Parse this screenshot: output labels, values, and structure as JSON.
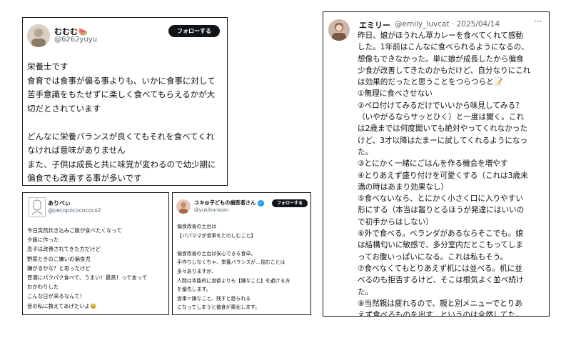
{
  "card1": {
    "name": "むむむ🍉",
    "handle": "@6262yuyu",
    "follow_label": "フォローする",
    "lines": [
      "栄養士です",
      "食育では食事が偏る事よりも、いかに食事に対して",
      "苦手意識をもたせずに楽しく食べてもらえるかが大",
      "切だとされています",
      "",
      "どんなに栄養バランスが良くてもそれを食べてくれ",
      "なければ意味がありません",
      "また、子供は成長と共に味覚が変わるので幼少期に",
      "偏食でも改善する事が多いです"
    ]
  },
  "card2": {
    "name": "ありべぃ",
    "handle": "@pecopococococo2",
    "lines": [
      "今日突然炊き込みご飯が食べたくなって",
      "夕飯に作った",
      "息子は改善されてきた方だけど",
      "野菜ときのこ嫌いの偏食児",
      "嫌がるかな？と思ったけど",
      "普通にパクパク食べて、うまい！最高！って言って",
      "おかわりした",
      "こんな日が来るなんて！",
      "昔の私に教えてあげたいよ🥹"
    ]
  },
  "card3": {
    "name": "ユキ@子どもの歯医者さん",
    "handle": "@yukiharasan",
    "follow_label": "フォローする",
    "lines": [
      "偏食改善の土台は",
      "【パパママが食事をたのしむこと】",
      "",
      "偏食改善の土台は安心できる食卓。",
      "手作りしなくちゃ、栄養バランスが…悩むことは",
      "多々ありますが、",
      "人間は本能的に食欲よりも【嫌なこと】を避ける方",
      "を優先します。",
      "食事＝嫌なこと、残すと怒られる",
      "になってしまうと偏食が悪化します。"
    ]
  },
  "card4": {
    "name": "エミリー",
    "handle": "@emily_luvcat · 2025/04/14",
    "more": "···",
    "lines": [
      "昨日、娘がほうれん草カレーを食べてくれて感動",
      "した。1年前はこんなに食べられるようになるの、",
      "想像もできなかった。単に娘が成長したから偏食",
      "少食が改善してきたのかもだけど、自分なりにこれ",
      "は効果的だったと思うことをつらつらと📝",
      "①無理に食べさせない",
      "②ペロ付けてみるだけでいいから味見してみる？",
      "（いやがるならサッとひく）と一度は聞く。これ",
      "は2歳までは何度聞いても絶対やってくれなかった",
      "けど、3才以降はたまーに試してくれるようになっ",
      "た。",
      "③とにかく一緒にごはんを作る機会を増やす",
      "④とりあえず盛り付けを可愛くする（これは3歳未",
      "満の時はあまり効果なし）",
      "⑤食べないなら、とにかく小さく口に入りやすい",
      "形にする（本当は齧りとるほうが発達にはいいの",
      "で初手からはしない）",
      "⑥外で食べる。ベランダがあるならそこでも。娘",
      "は結構匂いに敏感で、多分室内だとこもってしま",
      "ってお腹いっぱいになる。これは私もそう。",
      "⑦食べなくてもとりあえず机には並べる。机に並",
      "べるのも拒否するけど、そこは根気よく並べ続け",
      "た。",
      "⑧当然親は疲れるので、親と別メニューでとりあ",
      "えず食べるものを出す、というのは全然してた。"
    ]
  },
  "icons": {
    "verified": "verified-badge-icon",
    "avatar_placeholder": "avatar-icon"
  }
}
